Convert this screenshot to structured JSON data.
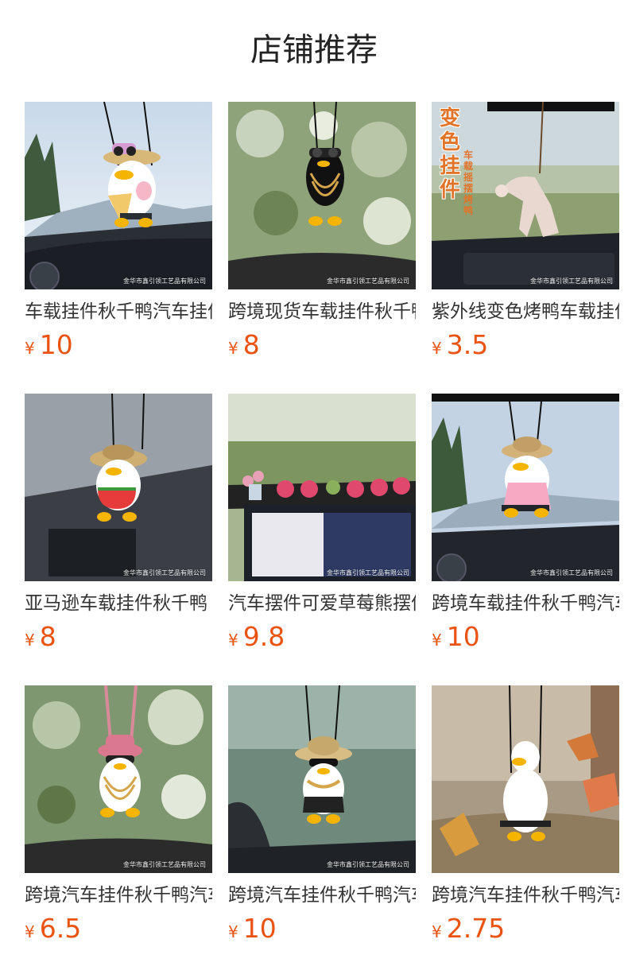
{
  "section_title": "店铺推荐",
  "watermark": "金华市鑫引领工艺品有限公司",
  "currency_symbol": "¥",
  "overlay_text": {
    "main": "变色挂件",
    "sub": "车载摇摆烤鸭"
  },
  "products": [
    {
      "name": "车载挂件秋千鸭汽车挂件",
      "price": "10",
      "icon": "duck-straw-hat-icecream"
    },
    {
      "name": "跨境现货车载挂件秋千鸭",
      "price": "8",
      "icon": "duck-black-sunglasses-chain"
    },
    {
      "name": "紫外线变色烤鸭车载挂件",
      "price": "3.5",
      "icon": "swing-roast-duck"
    },
    {
      "name": "亚马逊车载挂件秋千鸭",
      "price": "8",
      "icon": "duck-straw-hat-watermelon"
    },
    {
      "name": "汽车摆件可爱草莓熊摆件",
      "price": "9.8",
      "icon": "strawberry-bear-figures"
    },
    {
      "name": "跨境车载挂件秋千鸭汽车",
      "price": "10",
      "icon": "duck-straw-hat-pink-dress"
    },
    {
      "name": "跨境汽车挂件秋千鸭汽车",
      "price": "6.5",
      "icon": "duck-pink-hat-gold-chain"
    },
    {
      "name": "跨境汽车挂件秋千鸭汽车",
      "price": "10",
      "icon": "duck-straw-hat-sunglasses"
    },
    {
      "name": "跨境汽车挂件秋千鸭汽车",
      "price": "2.75",
      "icon": "white-duck-swing"
    }
  ]
}
